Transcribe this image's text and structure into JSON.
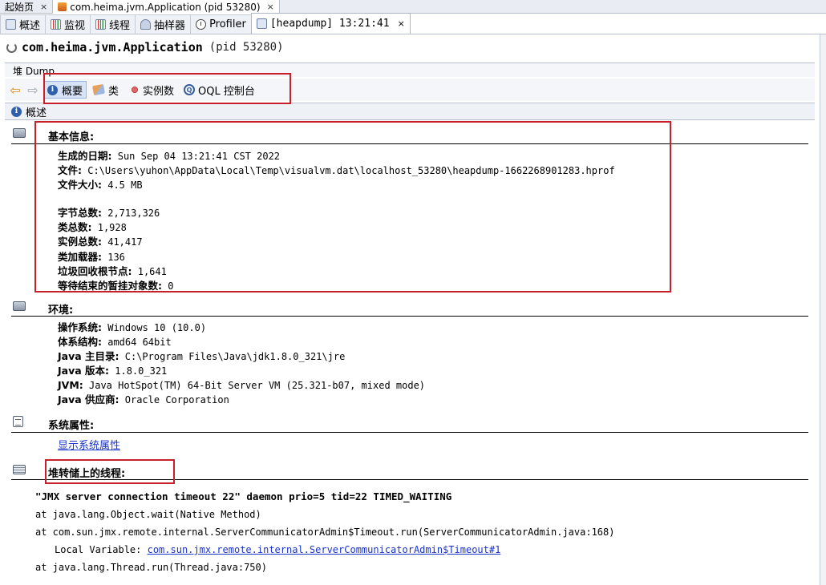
{
  "doc_tabs": [
    {
      "label": "起始页",
      "close": "×"
    },
    {
      "label": "com.heima.jvm.Application (pid 53280)",
      "close": "×"
    }
  ],
  "tool_tabs": [
    {
      "label": "概述",
      "icon": "overview-icon"
    },
    {
      "label": "监视",
      "icon": "monitor-icon"
    },
    {
      "label": "线程",
      "icon": "threads-icon"
    },
    {
      "label": "抽样器",
      "icon": "sampler-icon"
    },
    {
      "label": "Profiler",
      "icon": "profiler-icon"
    },
    {
      "label": "[heapdump] 13:21:41",
      "icon": "heapdump-icon",
      "close": "×"
    }
  ],
  "header": {
    "app_name": "com.heima.jvm.Application",
    "pid": "(pid 53280)"
  },
  "heap_dump_label": "堆 Dump",
  "nav": {
    "back": "back-arrow-icon",
    "forward": "forward-arrow-icon",
    "buttons": [
      {
        "label": "概要",
        "active": true
      },
      {
        "label": "类",
        "active": false
      },
      {
        "label": "实例数",
        "active": false
      },
      {
        "label": "OQL 控制台",
        "active": false
      }
    ]
  },
  "section_label": "概述",
  "basic_info": {
    "title": "基本信息:",
    "rows": [
      {
        "k": "生成的日期:",
        "v": " Sun Sep 04 13:21:41 CST 2022"
      },
      {
        "k": "文件:",
        "v": " C:\\Users\\yuhon\\AppData\\Local\\Temp\\visualvm.dat\\localhost_53280\\heapdump-1662268901283.hprof"
      },
      {
        "k": "文件大小:",
        "v": " 4.5 MB"
      },
      {
        "k": "字节总数:",
        "v": " 2,713,326"
      },
      {
        "k": "类总数:",
        "v": " 1,928"
      },
      {
        "k": "实例总数:",
        "v": " 41,417"
      },
      {
        "k": "类加载器:",
        "v": " 136"
      },
      {
        "k": "垃圾回收根节点:",
        "v": " 1,641"
      },
      {
        "k": "等待结束的暂挂对象数:",
        "v": " 0"
      }
    ]
  },
  "environment": {
    "title": "环境:",
    "rows": [
      {
        "k": "操作系统:",
        "v": " Windows 10 (10.0)"
      },
      {
        "k": "体系结构:",
        "v": " amd64 64bit"
      },
      {
        "k": "Java 主目录:",
        "v": " C:\\Program Files\\Java\\jdk1.8.0_321\\jre"
      },
      {
        "k": "Java 版本:",
        "v": " 1.8.0_321"
      },
      {
        "k": "JVM:",
        "v": " Java HotSpot(TM) 64-Bit Server VM (25.321-b07, mixed mode)"
      },
      {
        "k": "Java 供应商:",
        "v": " Oracle Corporation"
      }
    ]
  },
  "system_properties": {
    "title": "系统属性:",
    "link": "显示系统属性"
  },
  "threads": {
    "title": "堆转储上的线程:",
    "header": "\"JMX server connection timeout 22\" daemon prio=5 tid=22 TIMED_WAITING",
    "lines": [
      "at java.lang.Object.wait(Native Method)",
      "at com.sun.jmx.remote.internal.ServerCommunicatorAdmin$Timeout.run(ServerCommunicatorAdmin.java:168)",
      "at java.lang.Thread.run(Thread.java:750)"
    ],
    "local_var_label": "Local Variable:",
    "local_var_link": "com.sun.jmx.remote.internal.ServerCommunicatorAdmin$Timeout#1"
  },
  "colors": {
    "highlight_box": "#c8202a",
    "link": "#1a33c9"
  }
}
